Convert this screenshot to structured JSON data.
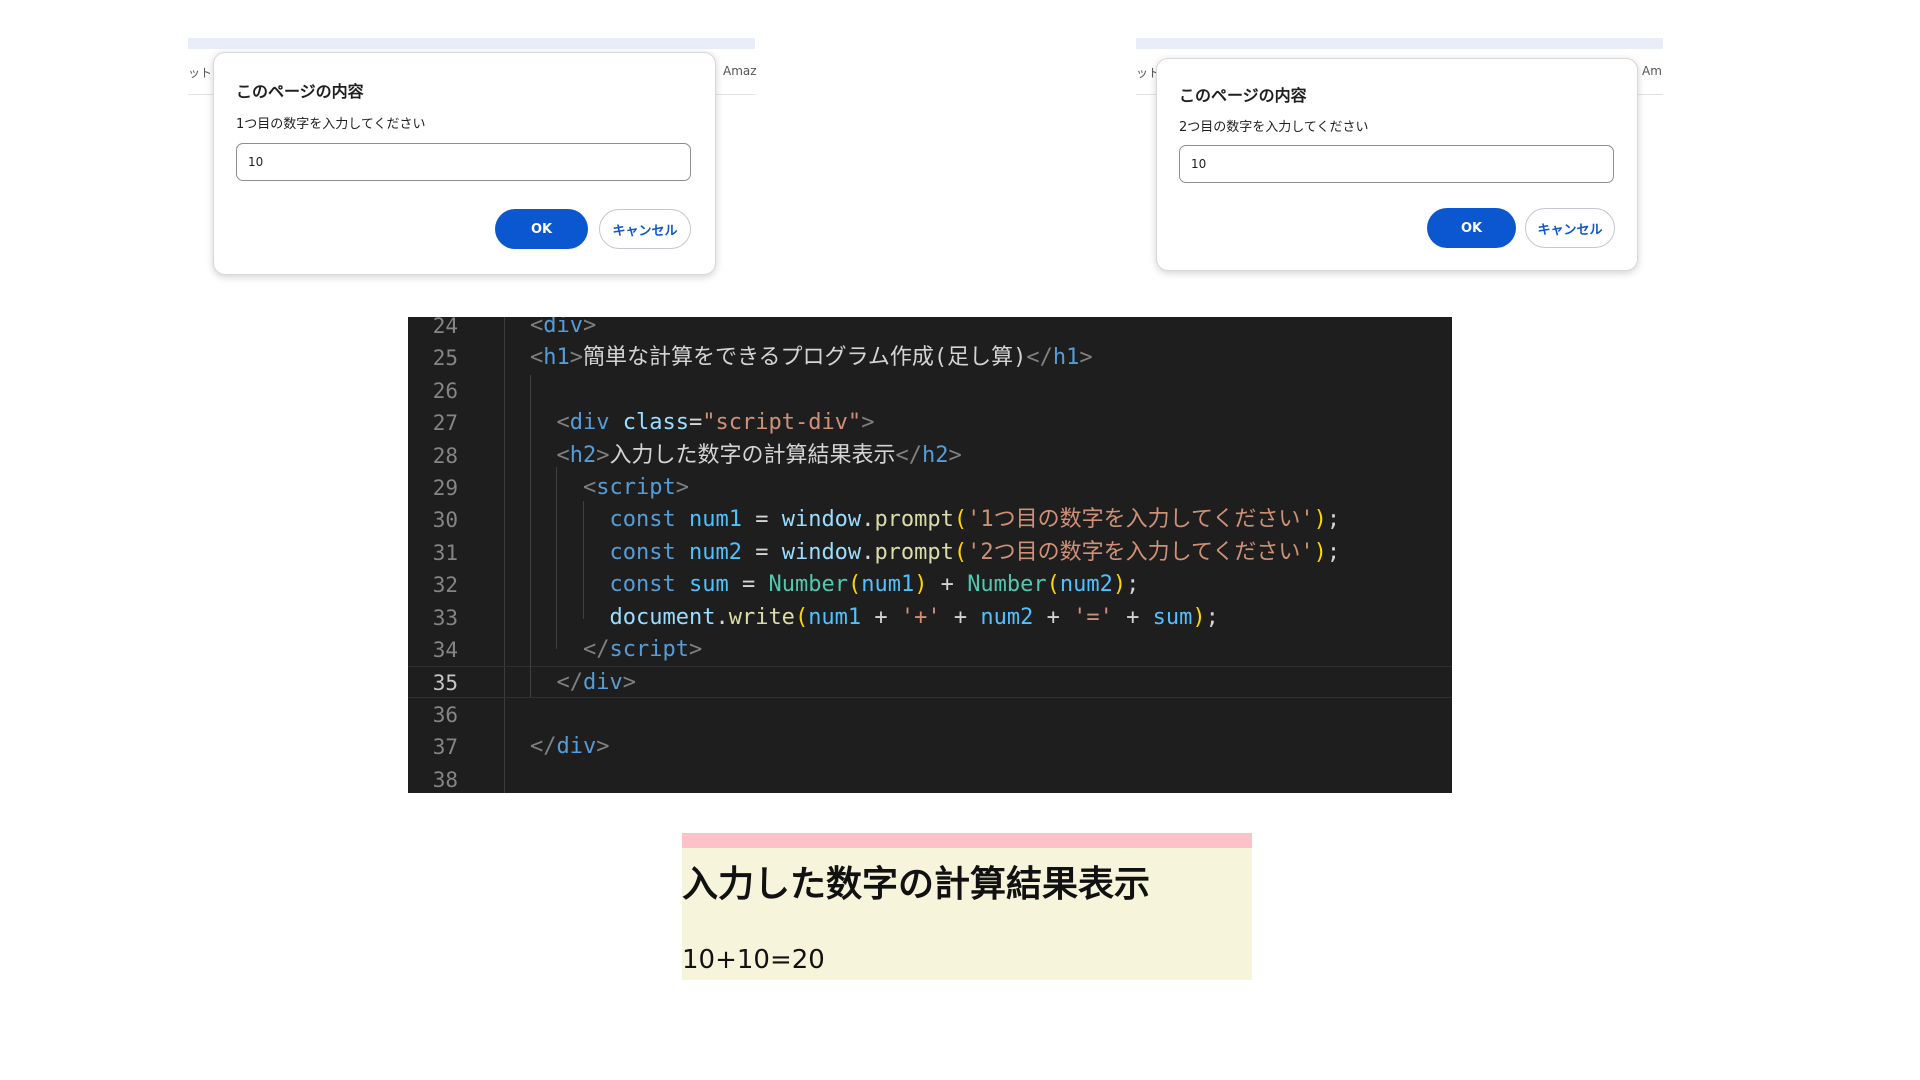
{
  "dialogs": [
    {
      "strip_left": "ット",
      "strip_right": "Amaz",
      "title": "このページの内容",
      "message": "1つ目の数字を入力してください",
      "input_value": "10",
      "ok_label": "OK",
      "cancel_label": "キャンセル"
    },
    {
      "strip_left": "ット",
      "strip_right": "Am",
      "title": "このページの内容",
      "message": "2つ目の数字を入力してください",
      "input_value": "10",
      "ok_label": "OK",
      "cancel_label": "キャンセル"
    }
  ],
  "editor": {
    "current_line": "35",
    "lines": [
      {
        "n": "24",
        "tokens": [
          [
            "p",
            "<"
          ],
          [
            "t",
            "div"
          ],
          [
            "p",
            ">"
          ]
        ]
      },
      {
        "n": "25",
        "tokens": [
          [
            "p",
            "<"
          ],
          [
            "t",
            "h1"
          ],
          [
            "p",
            ">"
          ],
          [
            "x",
            "簡単な計算をできるプログラム作成(足し算)"
          ],
          [
            "p",
            "</"
          ],
          [
            "t",
            "h1"
          ],
          [
            "p",
            ">"
          ]
        ]
      },
      {
        "n": "26",
        "tokens": []
      },
      {
        "n": "27",
        "tokens": [
          [
            "x",
            "  "
          ],
          [
            "p",
            "<"
          ],
          [
            "t",
            "div"
          ],
          [
            "x",
            " "
          ],
          [
            "a",
            "class"
          ],
          [
            "x",
            "="
          ],
          [
            "s",
            "\"script-div\""
          ],
          [
            "p",
            ">"
          ]
        ]
      },
      {
        "n": "28",
        "tokens": [
          [
            "x",
            "  "
          ],
          [
            "p",
            "<"
          ],
          [
            "t",
            "h2"
          ],
          [
            "p",
            ">"
          ],
          [
            "x",
            "入力した数字の計算結果表示"
          ],
          [
            "p",
            "</"
          ],
          [
            "t",
            "h2"
          ],
          [
            "p",
            ">"
          ]
        ]
      },
      {
        "n": "29",
        "tokens": [
          [
            "x",
            "    "
          ],
          [
            "p",
            "<"
          ],
          [
            "t",
            "script"
          ],
          [
            "p",
            ">"
          ]
        ]
      },
      {
        "n": "30",
        "tokens": [
          [
            "x",
            "      "
          ],
          [
            "k",
            "const"
          ],
          [
            "x",
            " "
          ],
          [
            "v",
            "num1"
          ],
          [
            "x",
            " = "
          ],
          [
            "a",
            "window"
          ],
          [
            "x",
            "."
          ],
          [
            "f",
            "prompt"
          ],
          [
            "b1",
            "("
          ],
          [
            "s",
            "'1つ目の数字を入力してください'"
          ],
          [
            "b1",
            ")"
          ],
          [
            "x",
            ";"
          ]
        ]
      },
      {
        "n": "31",
        "tokens": [
          [
            "x",
            "      "
          ],
          [
            "k",
            "const"
          ],
          [
            "x",
            " "
          ],
          [
            "v",
            "num2"
          ],
          [
            "x",
            " = "
          ],
          [
            "a",
            "window"
          ],
          [
            "x",
            "."
          ],
          [
            "f",
            "prompt"
          ],
          [
            "b1",
            "("
          ],
          [
            "s",
            "'2つ目の数字を入力してください'"
          ],
          [
            "b1",
            ")"
          ],
          [
            "x",
            ";"
          ]
        ]
      },
      {
        "n": "32",
        "tokens": [
          [
            "x",
            "      "
          ],
          [
            "k",
            "const"
          ],
          [
            "x",
            " "
          ],
          [
            "v",
            "sum"
          ],
          [
            "x",
            " = "
          ],
          [
            "c",
            "Number"
          ],
          [
            "b1",
            "("
          ],
          [
            "v",
            "num1"
          ],
          [
            "b1",
            ")"
          ],
          [
            "x",
            " + "
          ],
          [
            "c",
            "Number"
          ],
          [
            "b1",
            "("
          ],
          [
            "v",
            "num2"
          ],
          [
            "b1",
            ")"
          ],
          [
            "x",
            ";"
          ]
        ]
      },
      {
        "n": "33",
        "tokens": [
          [
            "x",
            "      "
          ],
          [
            "a",
            "document"
          ],
          [
            "x",
            "."
          ],
          [
            "f",
            "write"
          ],
          [
            "b1",
            "("
          ],
          [
            "v",
            "num1"
          ],
          [
            "x",
            " + "
          ],
          [
            "s",
            "'+'"
          ],
          [
            "x",
            " + "
          ],
          [
            "v",
            "num2"
          ],
          [
            "x",
            " + "
          ],
          [
            "s",
            "'='"
          ],
          [
            "x",
            " + "
          ],
          [
            "v",
            "sum"
          ],
          [
            "b1",
            ")"
          ],
          [
            "x",
            ";"
          ]
        ]
      },
      {
        "n": "34",
        "tokens": [
          [
            "x",
            "    "
          ],
          [
            "p",
            "</"
          ],
          [
            "t",
            "script"
          ],
          [
            "p",
            ">"
          ]
        ]
      },
      {
        "n": "35",
        "tokens": [
          [
            "x",
            "  "
          ],
          [
            "p",
            "</"
          ],
          [
            "t",
            "div"
          ],
          [
            "p",
            ">"
          ]
        ]
      },
      {
        "n": "36",
        "tokens": []
      },
      {
        "n": "37",
        "tokens": [
          [
            "p",
            "</"
          ],
          [
            "t",
            "div"
          ],
          [
            "p",
            ">"
          ]
        ]
      },
      {
        "n": "38",
        "tokens": []
      }
    ]
  },
  "result": {
    "heading": "入力した数字の計算結果表示",
    "output": "10+10=20"
  }
}
